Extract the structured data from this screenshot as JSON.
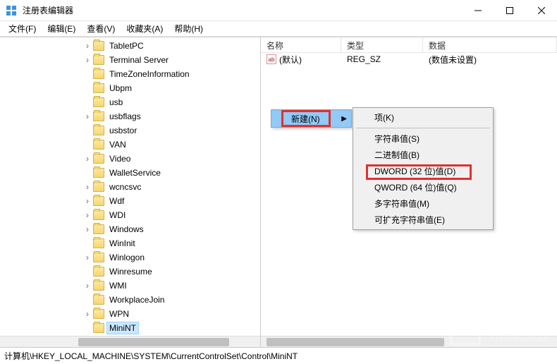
{
  "window": {
    "title": "注册表编辑器"
  },
  "menu": {
    "file": "文件(F)",
    "edit": "编辑(E)",
    "view": "查看(V)",
    "favorites": "收藏夹(A)",
    "help": "帮助(H)"
  },
  "tree": {
    "items": [
      {
        "label": "TabletPC",
        "indent": 1,
        "exp": "closed"
      },
      {
        "label": "Terminal Server",
        "indent": 1,
        "exp": "closed"
      },
      {
        "label": "TimeZoneInformation",
        "indent": 1,
        "exp": "none"
      },
      {
        "label": "Ubpm",
        "indent": 1,
        "exp": "none"
      },
      {
        "label": "usb",
        "indent": 1,
        "exp": "none"
      },
      {
        "label": "usbflags",
        "indent": 1,
        "exp": "closed"
      },
      {
        "label": "usbstor",
        "indent": 1,
        "exp": "none"
      },
      {
        "label": "VAN",
        "indent": 1,
        "exp": "none"
      },
      {
        "label": "Video",
        "indent": 1,
        "exp": "closed"
      },
      {
        "label": "WalletService",
        "indent": 1,
        "exp": "none"
      },
      {
        "label": "wcncsvc",
        "indent": 1,
        "exp": "closed"
      },
      {
        "label": "Wdf",
        "indent": 1,
        "exp": "closed"
      },
      {
        "label": "WDI",
        "indent": 1,
        "exp": "closed"
      },
      {
        "label": "Windows",
        "indent": 1,
        "exp": "closed"
      },
      {
        "label": "WinInit",
        "indent": 1,
        "exp": "none"
      },
      {
        "label": "Winlogon",
        "indent": 1,
        "exp": "closed"
      },
      {
        "label": "Winresume",
        "indent": 1,
        "exp": "none"
      },
      {
        "label": "WMI",
        "indent": 1,
        "exp": "closed"
      },
      {
        "label": "WorkplaceJoin",
        "indent": 1,
        "exp": "none"
      },
      {
        "label": "WPN",
        "indent": 1,
        "exp": "closed"
      },
      {
        "label": "MiniNT",
        "indent": 1,
        "exp": "none",
        "selected": true
      }
    ]
  },
  "list": {
    "headers": {
      "name": "名称",
      "type": "类型",
      "data": "数据"
    },
    "rows": [
      {
        "icon": "ab",
        "name": "(默认)",
        "type": "REG_SZ",
        "data": "(数值未设置)"
      }
    ]
  },
  "context_main": {
    "new": "新建(N)"
  },
  "context_sub": {
    "key": "项(K)",
    "string": "字符串值(S)",
    "binary": "二进制值(B)",
    "dword": "DWORD (32 位)值(D)",
    "qword": "QWORD (64 位)值(Q)",
    "multi": "多字符串值(M)",
    "expand": "可扩充字符串值(E)"
  },
  "statusbar": {
    "path": "计算机\\HKEY_LOCAL_MACHINE\\SYSTEM\\CurrentControlSet\\Control\\MiniNT"
  },
  "watermark": {
    "text": "系统之家",
    "url": "XITONGZHIJIA.NET"
  }
}
